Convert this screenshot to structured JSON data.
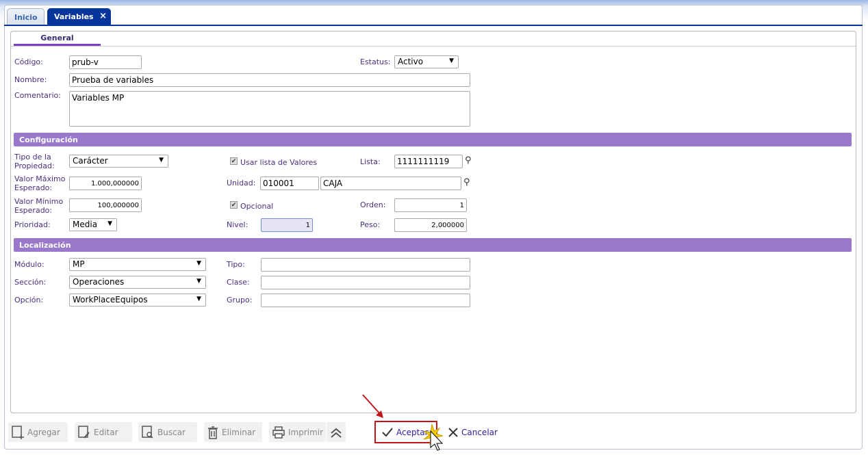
{
  "tabs": [
    {
      "label": "Inicio"
    },
    {
      "label": "Variables",
      "close": "×"
    }
  ],
  "subtab": "General",
  "fields": {
    "codigo": {
      "label": "Código:",
      "value": "prub-v"
    },
    "estatus": {
      "label": "Estatus:",
      "value": "Activo"
    },
    "nombre": {
      "label": "Nombre:",
      "value": "Prueba de variables"
    },
    "comentario": {
      "label": "Comentario:",
      "value": "Variables MP"
    }
  },
  "config": {
    "title": "Configuración",
    "tipo": {
      "label1": "Tipo de la",
      "label2": "Propiedad:",
      "value": "Carácter"
    },
    "usar_lista": {
      "label": "Usar lista de Valores",
      "checked": true
    },
    "lista": {
      "label": "Lista:",
      "value": "1111111119"
    },
    "vmax": {
      "label1": "Valor Máximo",
      "label2": "Esperado:",
      "value": "1.000,000000"
    },
    "unidad": {
      "label": "Unidad:",
      "code": "010001",
      "name": "CAJA"
    },
    "vmin": {
      "label1": "Valor Mínimo",
      "label2": "Esperado:",
      "value": "100,000000"
    },
    "opcional": {
      "label": "Opcional",
      "checked": true
    },
    "orden": {
      "label": "Orden:",
      "value": "1"
    },
    "prioridad": {
      "label": "Prioridad:",
      "value": "Media"
    },
    "nivel": {
      "label": "Nivel:",
      "value": "1"
    },
    "peso": {
      "label": "Peso:",
      "value": "2,000000"
    }
  },
  "loc": {
    "title": "Localización",
    "modulo": {
      "label": "Módulo:",
      "value": "MP"
    },
    "seccion": {
      "label": "Sección:",
      "value": "Operaciones"
    },
    "opcion": {
      "label": "Opción:",
      "value": "WorkPlaceEquipos"
    },
    "tipo": {
      "label": "Tipo:",
      "value": ""
    },
    "clase": {
      "label": "Clase:",
      "value": ""
    },
    "grupo": {
      "label": "Grupo:",
      "value": ""
    }
  },
  "toolbar": {
    "agregar": "Agregar",
    "editar": "Editar",
    "buscar": "Buscar",
    "eliminar": "Eliminar",
    "imprimir": "Imprimir",
    "aceptar": "Aceptar",
    "cancelar": "Cancelar"
  },
  "colors": {
    "accent": "#04359a",
    "section": "#9a78cc",
    "highlight": "#c0161b"
  }
}
